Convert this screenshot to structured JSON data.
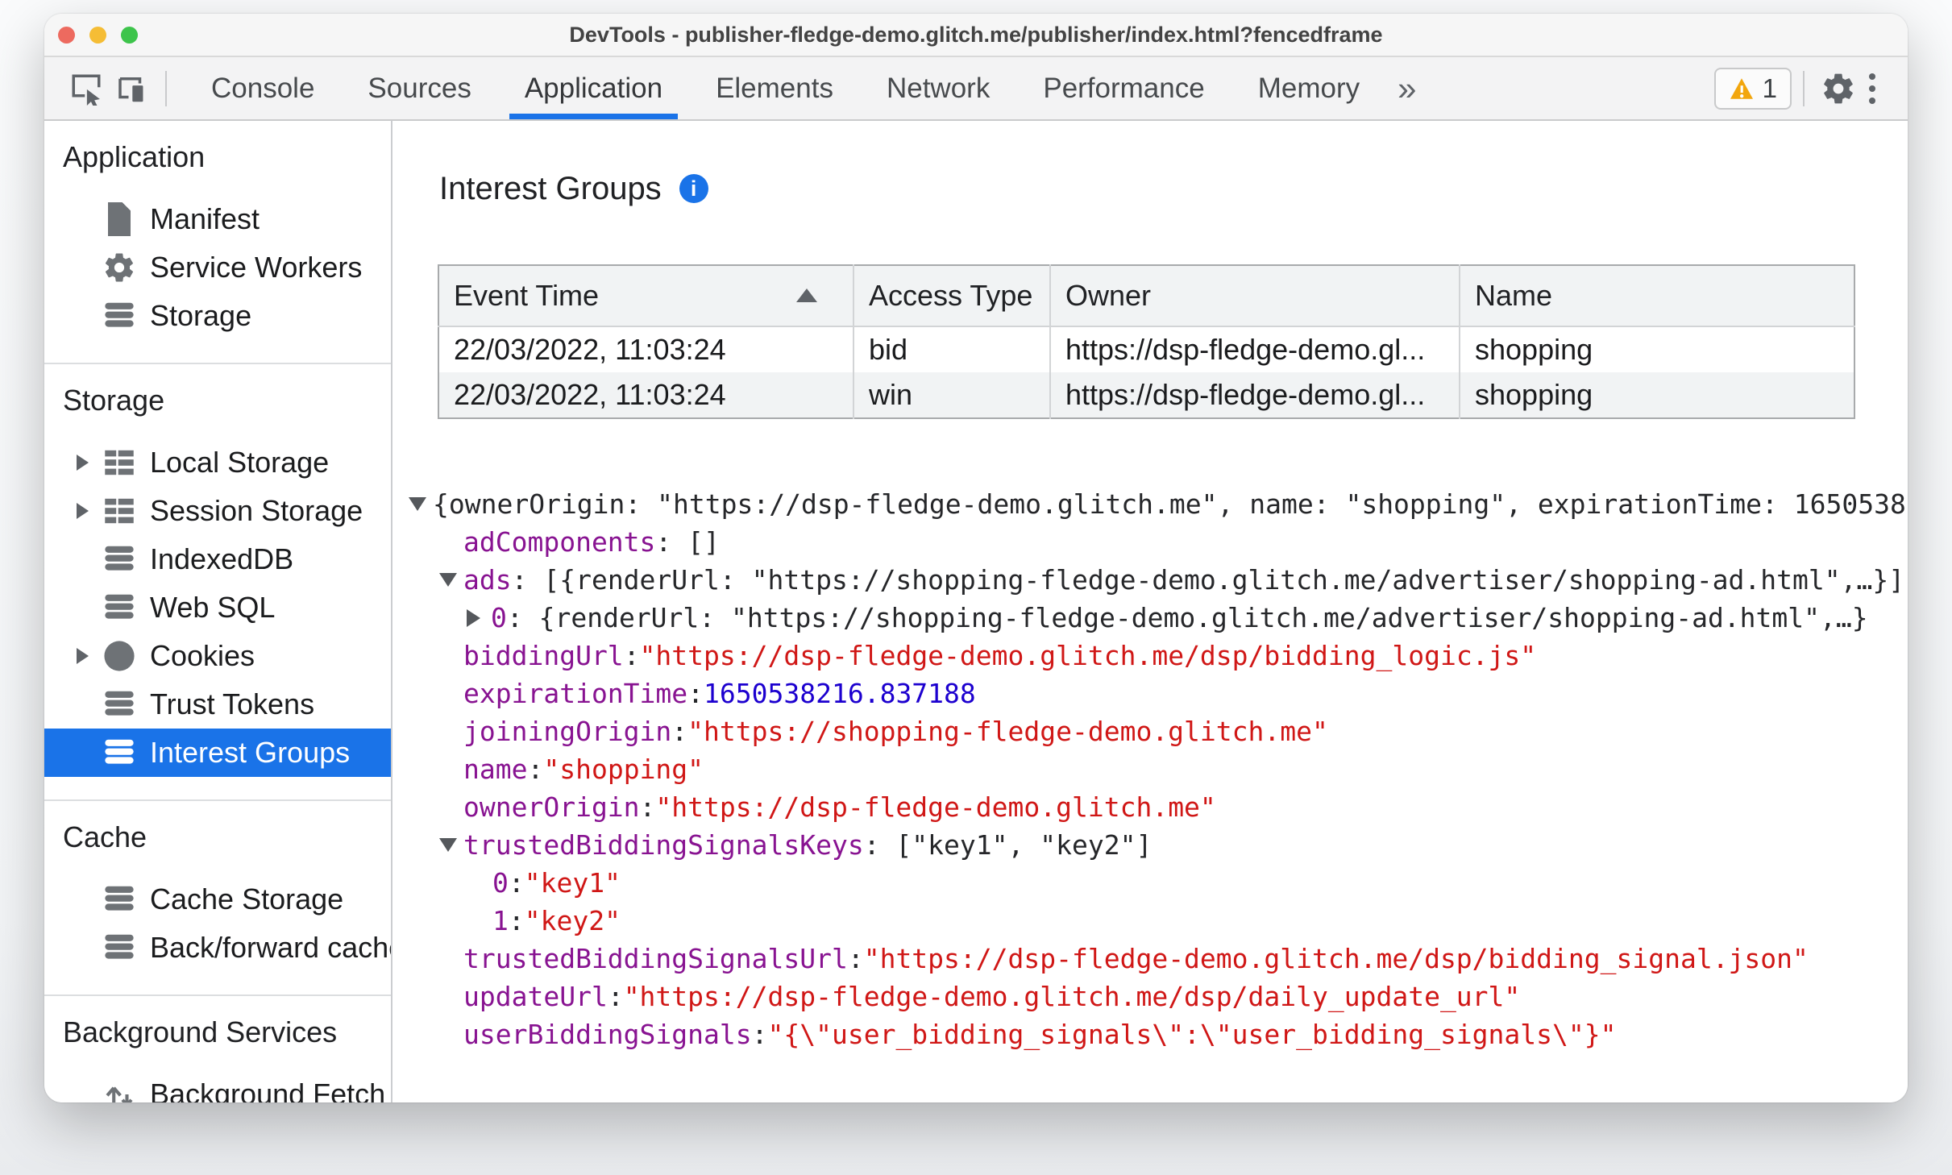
{
  "colors": {
    "accent_blue": "#1a73e8",
    "key_purple": "#881391",
    "string_red": "#d01716",
    "number_blue": "#1c00cf",
    "warning_orange": "#f2a60d",
    "selection_bg": "#1a73e8"
  },
  "window": {
    "title": "DevTools - publisher-fledge-demo.glitch.me/publisher/index.html?fencedframe"
  },
  "toolbar": {
    "tabs": [
      {
        "label": "Console"
      },
      {
        "label": "Sources"
      },
      {
        "label": "Application"
      },
      {
        "label": "Elements"
      },
      {
        "label": "Network"
      },
      {
        "label": "Performance"
      },
      {
        "label": "Memory"
      }
    ],
    "active_tab": "Application",
    "overflow_label": "»",
    "warning_count": "1"
  },
  "sidebar": {
    "sections": [
      {
        "title": "Application",
        "items": [
          {
            "label": "Manifest",
            "icon": "document-icon"
          },
          {
            "label": "Service Workers",
            "icon": "gear-icon"
          },
          {
            "label": "Storage",
            "icon": "database-icon"
          }
        ]
      },
      {
        "title": "Storage",
        "items": [
          {
            "label": "Local Storage",
            "icon": "table-icon",
            "expandable": true
          },
          {
            "label": "Session Storage",
            "icon": "table-icon",
            "expandable": true
          },
          {
            "label": "IndexedDB",
            "icon": "database-icon"
          },
          {
            "label": "Web SQL",
            "icon": "database-icon"
          },
          {
            "label": "Cookies",
            "icon": "cookie-icon",
            "expandable": true
          },
          {
            "label": "Trust Tokens",
            "icon": "database-icon"
          },
          {
            "label": "Interest Groups",
            "icon": "database-icon",
            "selected": true
          }
        ]
      },
      {
        "title": "Cache",
        "items": [
          {
            "label": "Cache Storage",
            "icon": "database-icon"
          },
          {
            "label": "Back/forward cache",
            "icon": "database-icon"
          }
        ]
      },
      {
        "title": "Background Services",
        "items": [
          {
            "label": "Background Fetch",
            "icon": "fetch-arrows-icon"
          }
        ]
      }
    ]
  },
  "main": {
    "title": "Interest Groups",
    "table": {
      "columns": [
        "Event Time",
        "Access Type",
        "Owner",
        "Name"
      ],
      "sorted_column": "Event Time",
      "sort_direction": "ascending",
      "rows": [
        [
          "22/03/2022, 11:03:24",
          "bid",
          "https://dsp-fledge-demo.gl...",
          "shopping"
        ],
        [
          "22/03/2022, 11:03:24",
          "win",
          "https://dsp-fledge-demo.gl...",
          "shopping"
        ]
      ]
    },
    "tree": {
      "lines": [
        {
          "arrow": "down",
          "segments": [
            {
              "type": "plain",
              "text": "{ownerOrigin: \"https://dsp-fledge-demo.glitch.me\", name: \"shopping\", expirationTime: 1650538"
            }
          ]
        },
        {
          "arrow": null,
          "segments": [
            {
              "type": "key",
              "text": "adComponents"
            },
            {
              "type": "plain",
              "text": ": []"
            }
          ]
        },
        {
          "arrow": "down",
          "segments": [
            {
              "type": "key",
              "text": "ads"
            },
            {
              "type": "plain",
              "text": ": [{renderUrl: \"https://shopping-fledge-demo.glitch.me/advertiser/shopping-ad.html\",…}]"
            }
          ]
        },
        {
          "arrow": "right",
          "segments": [
            {
              "type": "key",
              "text": "0"
            },
            {
              "type": "plain",
              "text": ": {renderUrl: \"https://shopping-fledge-demo.glitch.me/advertiser/shopping-ad.html\",…}"
            }
          ]
        },
        {
          "arrow": null,
          "segments": [
            {
              "type": "key",
              "text": "biddingUrl"
            },
            {
              "type": "plain",
              "text": ": "
            },
            {
              "type": "string",
              "text": "\"https://dsp-fledge-demo.glitch.me/dsp/bidding_logic.js\""
            }
          ]
        },
        {
          "arrow": null,
          "segments": [
            {
              "type": "key",
              "text": "expirationTime"
            },
            {
              "type": "plain",
              "text": ": "
            },
            {
              "type": "number",
              "text": "1650538216.837188"
            }
          ]
        },
        {
          "arrow": null,
          "segments": [
            {
              "type": "key",
              "text": "joiningOrigin"
            },
            {
              "type": "plain",
              "text": ": "
            },
            {
              "type": "string",
              "text": "\"https://shopping-fledge-demo.glitch.me\""
            }
          ]
        },
        {
          "arrow": null,
          "segments": [
            {
              "type": "key",
              "text": "name"
            },
            {
              "type": "plain",
              "text": ": "
            },
            {
              "type": "string",
              "text": "\"shopping\""
            }
          ]
        },
        {
          "arrow": null,
          "segments": [
            {
              "type": "key",
              "text": "ownerOrigin"
            },
            {
              "type": "plain",
              "text": ": "
            },
            {
              "type": "string",
              "text": "\"https://dsp-fledge-demo.glitch.me\""
            }
          ]
        },
        {
          "arrow": "down",
          "segments": [
            {
              "type": "key",
              "text": "trustedBiddingSignalsKeys"
            },
            {
              "type": "plain",
              "text": ": [\"key1\", \"key2\"]"
            }
          ]
        },
        {
          "arrow": null,
          "segments": [
            {
              "type": "key",
              "text": "0"
            },
            {
              "type": "plain",
              "text": ": "
            },
            {
              "type": "string",
              "text": "\"key1\""
            }
          ]
        },
        {
          "arrow": null,
          "segments": [
            {
              "type": "key",
              "text": "1"
            },
            {
              "type": "plain",
              "text": ": "
            },
            {
              "type": "string",
              "text": "\"key2\""
            }
          ]
        },
        {
          "arrow": null,
          "segments": [
            {
              "type": "key",
              "text": "trustedBiddingSignalsUrl"
            },
            {
              "type": "plain",
              "text": ": "
            },
            {
              "type": "string",
              "text": "\"https://dsp-fledge-demo.glitch.me/dsp/bidding_signal.json\""
            }
          ]
        },
        {
          "arrow": null,
          "segments": [
            {
              "type": "key",
              "text": "updateUrl"
            },
            {
              "type": "plain",
              "text": ": "
            },
            {
              "type": "string",
              "text": "\"https://dsp-fledge-demo.glitch.me/dsp/daily_update_url\""
            }
          ]
        },
        {
          "arrow": null,
          "segments": [
            {
              "type": "key",
              "text": "userBiddingSignals"
            },
            {
              "type": "plain",
              "text": ": "
            },
            {
              "type": "string",
              "text": "\"{\\\"user_bidding_signals\\\":\\\"user_bidding_signals\\\"}\""
            }
          ]
        }
      ]
    }
  }
}
